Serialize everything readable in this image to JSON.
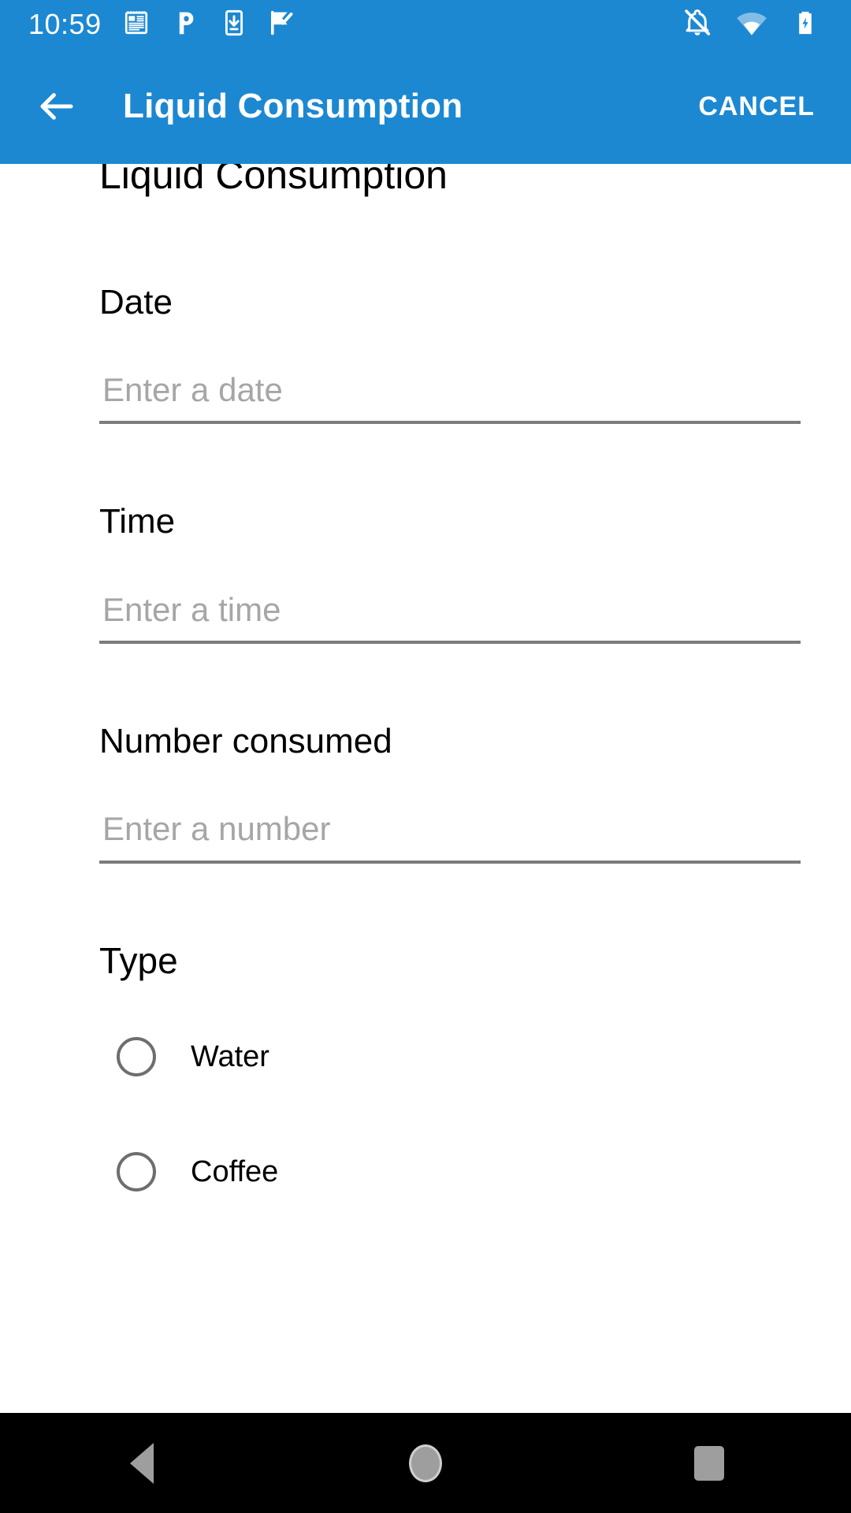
{
  "status_bar": {
    "clock": "10:59",
    "left_icons": [
      "news-notepad-icon",
      "pocket-p-icon",
      "download-to-phone-icon",
      "checkmark-flag-icon"
    ],
    "right_icons": [
      "notifications-silenced-icon",
      "wifi-icon",
      "battery-charging-icon"
    ],
    "background_color": "#1c88d2"
  },
  "app_bar": {
    "back_label": "back-arrow",
    "title": "Liquid Consumption",
    "cancel_label": "CANCEL",
    "background_color": "#1c88d2",
    "text_color": "#ffffff"
  },
  "page": {
    "heading": "Liquid Consumption"
  },
  "form": {
    "fields": [
      {
        "label": "Date",
        "placeholder": "Enter a date",
        "value": ""
      },
      {
        "label": "Time",
        "placeholder": "Enter a time",
        "value": ""
      },
      {
        "label": "Number consumed",
        "placeholder": "Enter a number",
        "value": ""
      }
    ],
    "type_group": {
      "label": "Type",
      "options": [
        {
          "label": "Water",
          "selected": false
        },
        {
          "label": "Coffee",
          "selected": false
        }
      ]
    }
  },
  "nav_bar": {
    "buttons": [
      "back-triangle-icon",
      "home-circle-icon",
      "recent-apps-square-icon"
    ],
    "background_color": "#000000",
    "icon_color": "#9e9e9e"
  },
  "colors": {
    "accent": "#1c88d2",
    "placeholder": "#a6a6a6",
    "underline": "#7c7c7c",
    "text": "#000000"
  }
}
